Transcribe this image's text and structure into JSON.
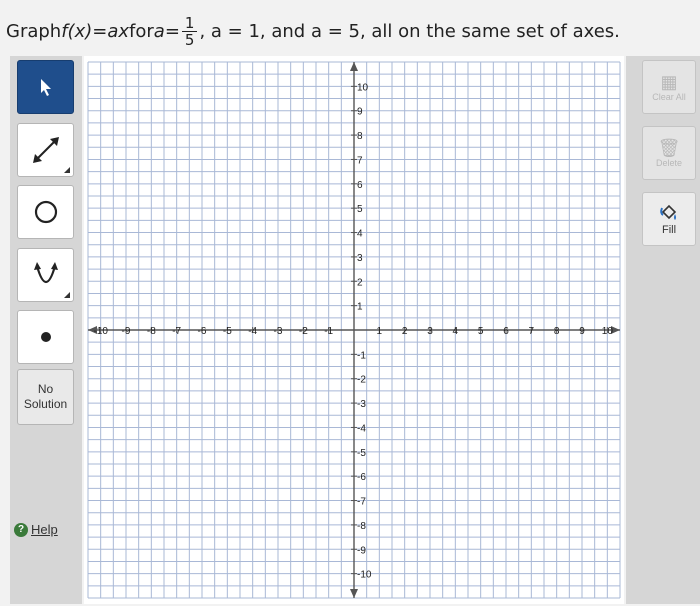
{
  "question": {
    "prefix": "Graph ",
    "fx": "f(x)",
    "eq": " = ",
    "ax": "ax",
    "for": " for ",
    "a1": "a",
    "eq2": " = ",
    "frac_num": "1",
    "frac_den": "5",
    "rest": ",  a = 1,  and  a = 5,  all on the same set of axes."
  },
  "tools": {
    "pointer_icon": "pointer-arrow-icon",
    "line_icon": "line-segment-icon",
    "circle_icon": "circle-icon",
    "parabola_icon": "parabola-icon",
    "point_icon": "point-icon",
    "no_solution": [
      "No",
      "Solution"
    ],
    "help": "Help",
    "help_icon": "?"
  },
  "right_tools": {
    "clear_all": "Clear All",
    "delete": "Delete",
    "fill": "Fill"
  },
  "graph": {
    "x_min": -10,
    "x_max": 10,
    "y_min": -10,
    "y_max": 10,
    "x_tick_labels": [
      "-10",
      "-9",
      "-8",
      "-7",
      "-6",
      "-5",
      "-4",
      "-3",
      "-2",
      "-1",
      "1",
      "2",
      "3",
      "4",
      "5",
      "6",
      "7",
      "8",
      "9",
      "10"
    ],
    "y_tick_labels": [
      "10",
      "9",
      "8",
      "7",
      "6",
      "5",
      "4",
      "3",
      "2",
      "1",
      "-1",
      "-2",
      "-3",
      "-4",
      "-5",
      "-6",
      "-7",
      "-8",
      "-9",
      "-10"
    ]
  },
  "colors": {
    "selected_tool": "#1f4e8c",
    "grid": "#a9b8d6",
    "axis": "#555555"
  }
}
